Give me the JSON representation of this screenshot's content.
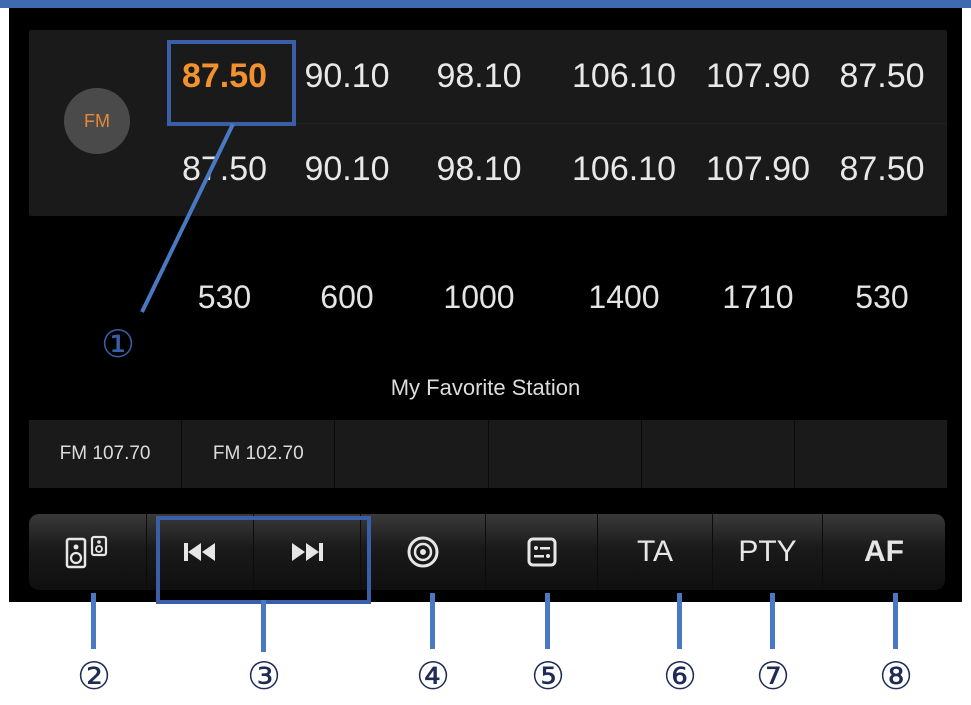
{
  "band_badge": "FM",
  "fm_presets_row1": [
    {
      "label": "87.50",
      "active": true
    },
    {
      "label": "90.10"
    },
    {
      "label": "98.10"
    },
    {
      "label": "106.10"
    },
    {
      "label": "107.90"
    },
    {
      "label": "87.50"
    }
  ],
  "fm_presets_row2": [
    "87.50",
    "90.10",
    "98.10",
    "106.10",
    "107.90",
    "87.50"
  ],
  "am_presets": [
    "530",
    "600",
    "1000",
    "1400",
    "1710",
    "530"
  ],
  "favorites": {
    "title": "My Favorite Station",
    "slots": [
      "FM 107.70",
      "FM 102.70",
      "",
      "",
      "",
      ""
    ]
  },
  "toolbar": {
    "speaker_icon": "speaker-icon",
    "prev_icon": "skip-previous-icon",
    "next_icon": "skip-next-icon",
    "scan_icon": "scan-icon",
    "list_icon": "list-icon",
    "ta": "TA",
    "pty": "PTY",
    "af": "AF"
  },
  "callouts": [
    "①",
    "②",
    "③",
    "④",
    "⑤",
    "⑥",
    "⑦",
    "⑧"
  ],
  "colors": {
    "active_freq": "#f2922f",
    "annotation": "#3a5fa6",
    "background": "#000000"
  }
}
